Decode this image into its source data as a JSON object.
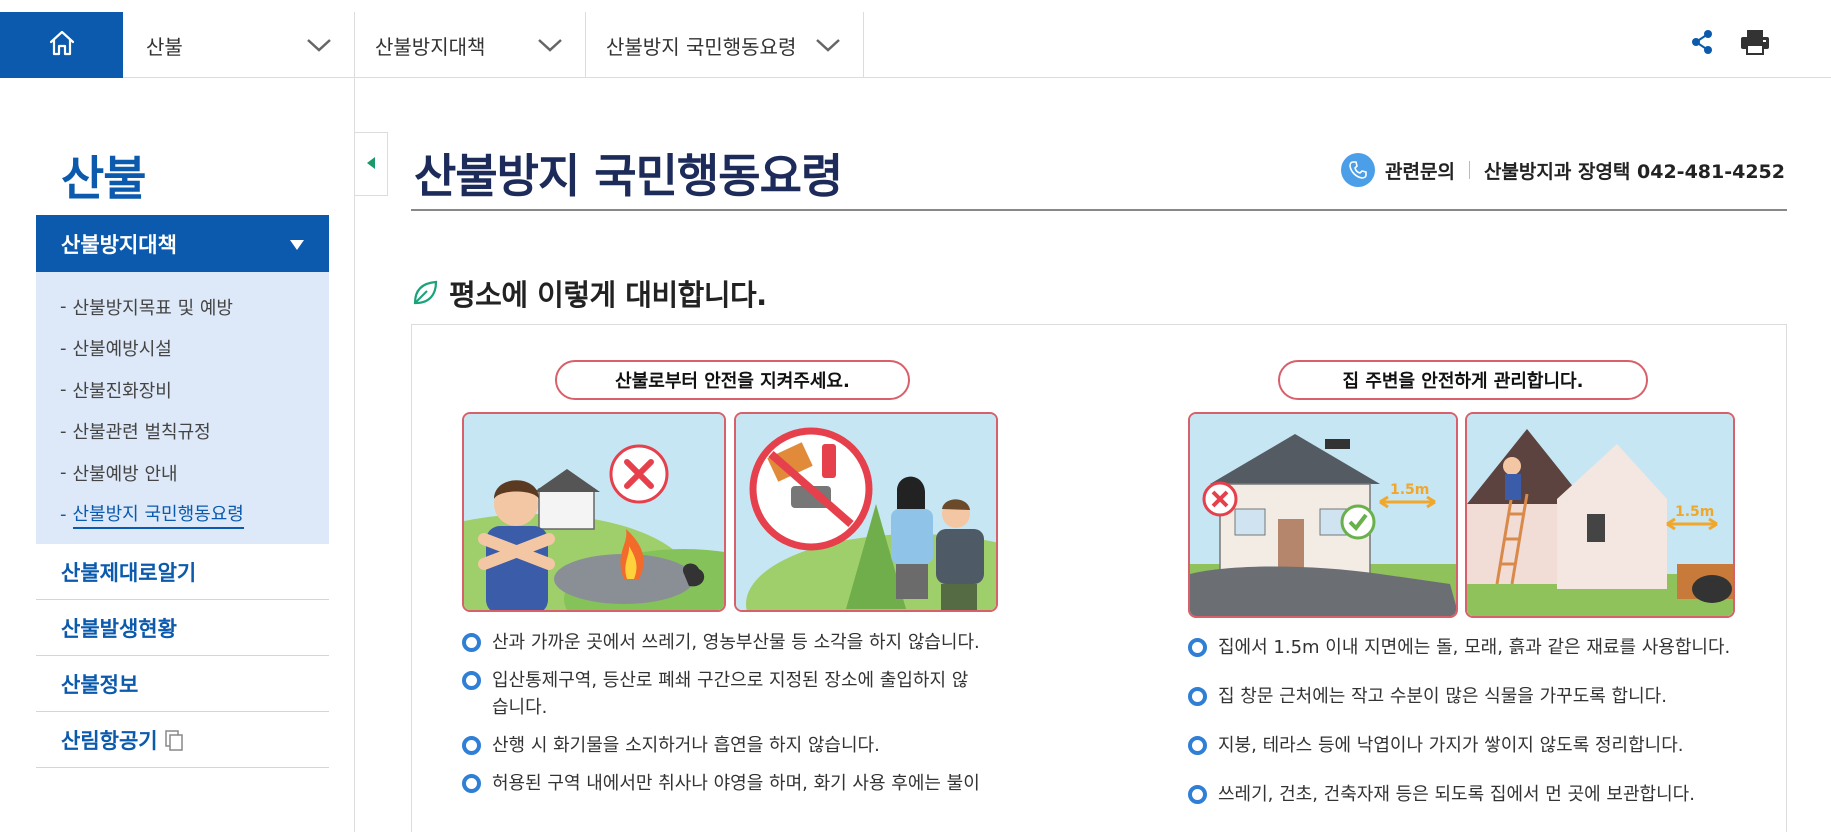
{
  "nav": {
    "menus": [
      {
        "label": "산불"
      },
      {
        "label": "산불방지대책"
      },
      {
        "label": "산불방지 국민행동요령"
      }
    ],
    "icons": {
      "home": "home-icon",
      "share": "share-icon",
      "print": "print-icon"
    },
    "accent": "#0b5aad"
  },
  "sidebar": {
    "title": "산불",
    "active_section": "산불방지대책",
    "sub_items": [
      {
        "label": "산불방지목표 및 예방"
      },
      {
        "label": "산불예방시설"
      },
      {
        "label": "산불진화장비"
      },
      {
        "label": "산불관련 벌칙규정"
      },
      {
        "label": "산불예방 안내"
      },
      {
        "label": "산불방지 국민행동요령"
      }
    ],
    "current_sub": "산불방지 국민행동요령",
    "items": [
      {
        "label": "산불제대로알기"
      },
      {
        "label": "산불발생현황"
      },
      {
        "label": "산불정보"
      },
      {
        "label": "산림항공기"
      }
    ],
    "dash": "-"
  },
  "main": {
    "title": "산불방지 국민행동요령",
    "contact": {
      "label": "관련문의",
      "value": "산불방지과 장영택 042-481-4252"
    },
    "section_title": "평소에 이렇게 대비합니다.",
    "left_panel": {
      "heading": "산불로부터 안전을 지켜주세요.",
      "bullets": [
        "산과 가까운 곳에서 쓰레기, 영농부산물 등 소각을 하지 않습니다.",
        "입산통제구역, 등산로 폐쇄 구간으로 지정된 장소에 출입하지 않습니다.",
        "산행 시 화기물을 소지하거나 흡연을 하지 않습니다.",
        "허용된 구역 내에서만 취사나 야영을 하며, 화기 사용 후에는 불이"
      ]
    },
    "right_panel": {
      "heading": "집 주변을 안전하게 관리합니다.",
      "distance_label": "1.5m",
      "bullets": [
        "집에서 1.5m 이내 지면에는 돌, 모래, 흙과 같은 재료를 사용합니다.",
        "집 창문 근처에는 작고 수분이 많은 식물을 가꾸도록 합니다.",
        "지붕, 테라스 등에 낙엽이나 가지가 쌓이지 않도록 정리합니다.",
        "쓰레기, 건초, 건축자재 등은 되도록 집에서 먼 곳에 보관합니다."
      ]
    }
  }
}
